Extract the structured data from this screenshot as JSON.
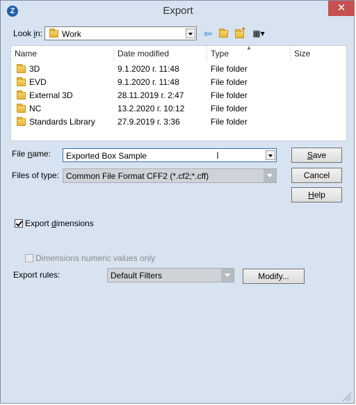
{
  "window": {
    "title": "Export",
    "close_glyph": "✕",
    "app_icon_letter": "Z"
  },
  "look_in": {
    "label_prefix": "Look ",
    "label_key": "i",
    "label_suffix": "n:",
    "value": "Work"
  },
  "toolbar": {
    "back_glyph": "⇦",
    "up_glyph": "⮤",
    "new_folder_glyph": "✦",
    "view_glyph": "▦▾"
  },
  "file_list": {
    "columns": [
      "Name",
      "Date modified",
      "Type",
      "Size"
    ],
    "rows": [
      {
        "name": "3D",
        "date": "9.1.2020 г. 11:48",
        "type": "File folder",
        "size": ""
      },
      {
        "name": "EVD",
        "date": "9.1.2020 г. 11:48",
        "type": "File folder",
        "size": ""
      },
      {
        "name": "External 3D",
        "date": "28.11.2019 г. 2:47",
        "type": "File folder",
        "size": ""
      },
      {
        "name": "NC",
        "date": "13.2.2020 г. 10:12",
        "type": "File folder",
        "size": ""
      },
      {
        "name": "Standards Library",
        "date": "27.9.2019 г. 3:36",
        "type": "File folder",
        "size": ""
      }
    ]
  },
  "file_name": {
    "label_prefix": "File ",
    "label_key": "n",
    "label_suffix": "ame:",
    "value": "Exported Box Sample"
  },
  "file_type": {
    "label": "Files of type:",
    "value": "Common File Format CFF2 (*.cf2;*.cff)"
  },
  "buttons": {
    "save_key": "S",
    "save_rest": "ave",
    "cancel": "Cancel",
    "help_key": "H",
    "help_rest": "elp",
    "modify": "Modify..."
  },
  "options": {
    "export_dimensions_prefix": "Export ",
    "export_dimensions_key": "d",
    "export_dimensions_suffix": "imensions",
    "export_dimensions_checked": true,
    "numeric_only": "Dimensions numeric values only",
    "numeric_only_checked": false
  },
  "export_rules": {
    "label": "Export rules:",
    "value": "Default Filters"
  }
}
